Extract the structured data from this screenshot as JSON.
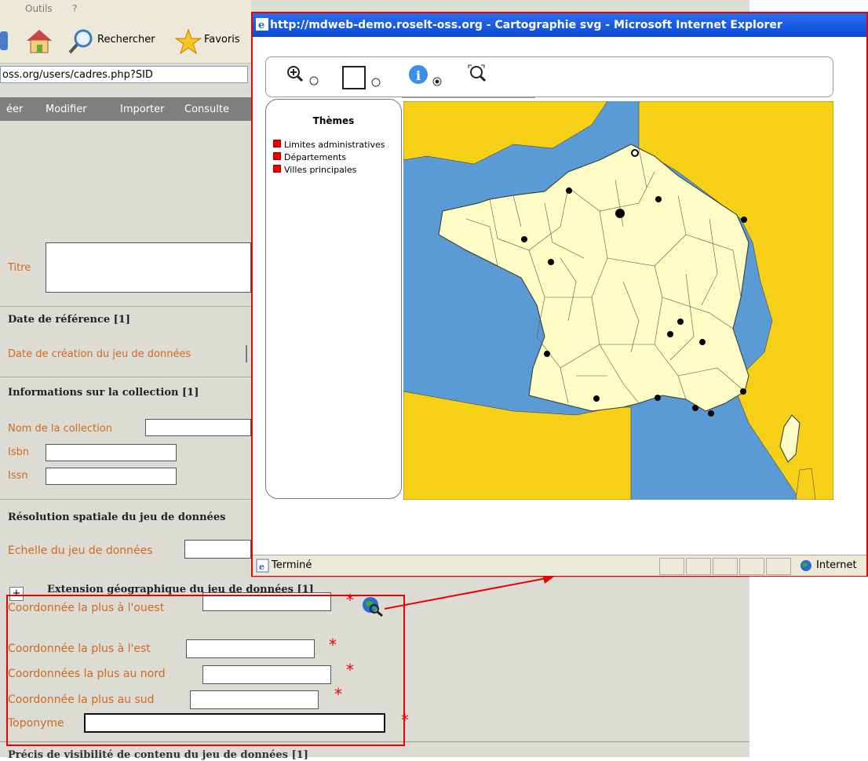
{
  "menubar": {
    "outils": "Outils",
    "help": "?"
  },
  "toolbar": {
    "rechercher": "Rechercher",
    "favoris": "Favoris"
  },
  "address": {
    "value": "oss.org/users/cadres.php?SID"
  },
  "nav": {
    "creer": "éer",
    "modifier": "Modifier",
    "importer": "Importer",
    "consulter": "Consulte"
  },
  "form": {
    "titre_label": "Titre",
    "date_ref_header": "Date de référence [1]",
    "date_creation_label": "Date de création du jeu de données",
    "collection_header": "Informations sur la collection [1]",
    "nom_collection_label": "Nom de la collection",
    "isbn_label": "Isbn",
    "issn_label": "Issn",
    "resolution_header": "Résolution spatiale du jeu de données",
    "echelle_label": "Echelle du jeu de données",
    "extension_toggle": "+",
    "extension_header": "Extension géographique du jeu de données [1]",
    "ouest_label": "Coordonnée la plus à l'ouest",
    "est_label": "Coordonnée la plus à l'est",
    "nord_label": "Coordonnées la plus au nord",
    "sud_label": "Coordonnée la plus au sud",
    "toponyme_label": "Toponyme",
    "required_mark": "*",
    "bottom_cut_header": "Précis de visibilité de contenu du jeu de données [1]"
  },
  "popup": {
    "title": "http://mdweb-demo.roselt-oss.org - Cartographie svg - Microsoft Internet Explorer",
    "status": "Terminé",
    "zone": "Internet",
    "themes_title": "Thèmes",
    "themes": [
      "Limites administratives",
      "Départements",
      "Villes principales"
    ]
  },
  "colors": {
    "sea": "#5b9bd5",
    "land": "#fdfdc5",
    "neighbours": "#f5d016",
    "accent_red": "#e00000",
    "label_orange": "#d2691e"
  }
}
